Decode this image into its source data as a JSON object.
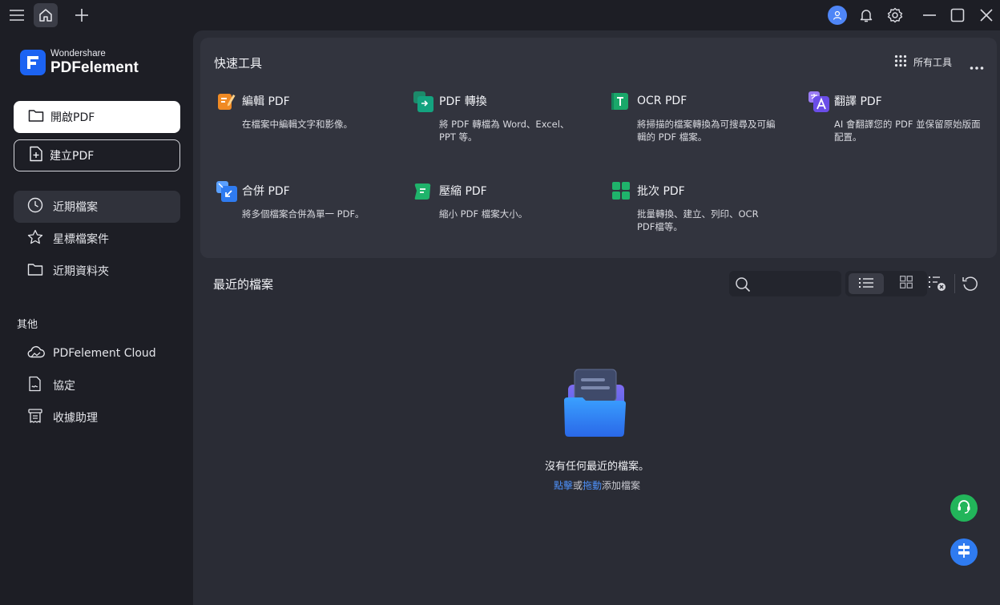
{
  "titlebar": {
    "icons": [
      "menu-icon",
      "home-icon",
      "plus-icon",
      "user-icon",
      "bell-icon",
      "gear-icon",
      "minimize-icon",
      "maximize-icon",
      "close-icon"
    ]
  },
  "brand": {
    "small": "Wondershare",
    "big": "PDFelement",
    "color": "#1c63f2"
  },
  "sidebar": {
    "open_label": "開啟PDF",
    "create_label": "建立PDF",
    "items": [
      {
        "label": "近期檔案",
        "icon": "clock-icon"
      },
      {
        "label": "星標檔案件",
        "icon": "star-icon"
      },
      {
        "label": "近期資料夾",
        "icon": "folder-icon"
      }
    ],
    "others_label": "其他",
    "others": [
      {
        "label": "PDFelement Cloud",
        "icon": "cloud-icon"
      },
      {
        "label": "協定",
        "icon": "contract-icon"
      },
      {
        "label": "收據助理",
        "icon": "receipt-icon"
      }
    ]
  },
  "quick_tools": {
    "title": "快速工具",
    "all_tools_label": "所有工具",
    "tools": [
      {
        "name": "編輯 PDF",
        "desc": "在檔案中編輯文字和影像。",
        "color": "#f08a24"
      },
      {
        "name": "PDF 轉換",
        "desc": "將 PDF 轉檔為 Word、Excel、PPT 等。",
        "color": "#14a37f"
      },
      {
        "name": "OCR PDF",
        "desc": "將掃描的檔案轉換為可搜尋及可編輯的 PDF 檔案。",
        "color": "#1aa86a"
      },
      {
        "name": "翻譯 PDF",
        "desc": "AI 會翻譯您的 PDF 並保留原始版面配置。",
        "color": "#7b5cf0"
      },
      {
        "name": "合併 PDF",
        "desc": "將多個檔案合併為單一 PDF。",
        "color": "#2f7bf0"
      },
      {
        "name": "壓縮 PDF",
        "desc": "縮小 PDF 檔案大小。",
        "color": "#1fb36b"
      },
      {
        "name": "批次 PDF",
        "desc": "批量轉換、建立、列印、OCR PDF檔等。",
        "color": "#1fb36b"
      }
    ]
  },
  "recent": {
    "title": "最近的檔案",
    "search_placeholder": "",
    "empty_title": "沒有任何最近的檔案。",
    "empty_link1": "點擊",
    "empty_or": "或",
    "empty_link2": "拖動",
    "empty_suffix": "添加檔案"
  },
  "colors": {
    "accent": "#4d8ff7",
    "support": "#22b55a",
    "feedback": "#2f7bf0"
  }
}
